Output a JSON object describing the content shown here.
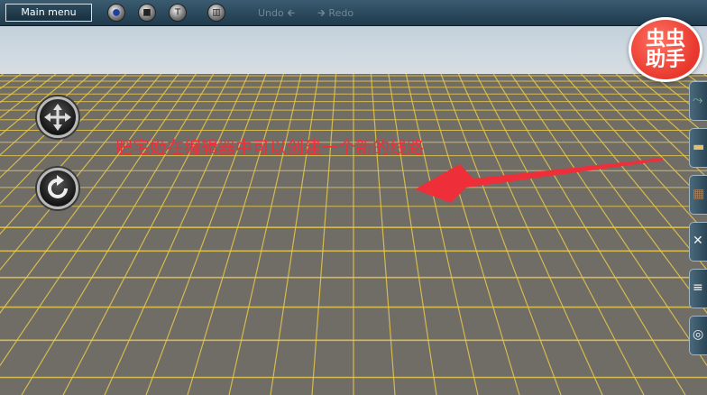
{
  "toolbar": {
    "main_menu_label": "Main menu",
    "undo_label": "Undo",
    "redo_label": "Redo",
    "tools": [
      {
        "icon": "globe-icon",
        "glyph": "●"
      },
      {
        "icon": "stop-icon",
        "glyph": "■"
      },
      {
        "icon": "brush-icon",
        "glyph": "T"
      },
      {
        "icon": "trash-icon",
        "glyph": "▥"
      }
    ]
  },
  "overlay": {
    "caption": "肥宅姬在编辑器中可以创建一个新的线路",
    "caption_color": "#ee2f3a"
  },
  "watermark": {
    "line1": "虫虫",
    "line2": "助手",
    "color": "#e8372c"
  },
  "side_buttons": [
    {
      "icon": "track-icon",
      "glyph": "⤳"
    },
    {
      "icon": "train-icon",
      "glyph": "▬"
    },
    {
      "icon": "building-icon",
      "glyph": "▦"
    },
    {
      "icon": "wrench-icon",
      "glyph": "✕"
    },
    {
      "icon": "layers-icon",
      "glyph": "≡"
    },
    {
      "icon": "settings-icon",
      "glyph": "◎"
    }
  ],
  "grid": {
    "ground_color": "#6f6d66",
    "line_color": "#e7c84a"
  }
}
